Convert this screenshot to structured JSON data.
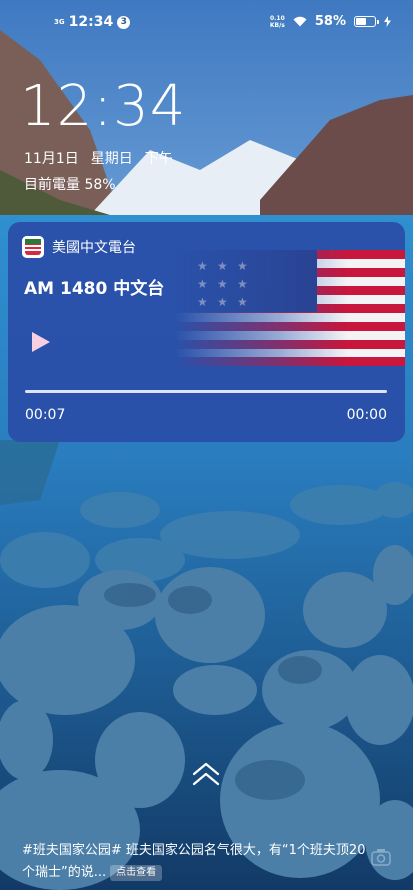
{
  "status_bar": {
    "network_type": "3G",
    "time": "12:34",
    "notification_count": "3",
    "net_speed_value": "0.10",
    "net_speed_unit": "KB/s",
    "battery_percent": "58%",
    "battery_level": 0.58
  },
  "lockscreen": {
    "clock": "12:34",
    "date": "11月1日",
    "weekday": "星期日",
    "ampm": "下午",
    "battery_info": "目前電量 58%"
  },
  "media_card": {
    "app_name": "美國中文電台",
    "title": "AM 1480 中文台",
    "elapsed": "00:07",
    "remaining": "00:00",
    "progress": 0.0
  },
  "bottom": {
    "caption": "#班夫国家公园# 班夫国家公园名气很大，有“1个班夫顶20个瑞士”的说...",
    "tag_label": "点击查看"
  },
  "icons": [
    "wifi-icon",
    "battery-icon",
    "charging-icon",
    "play-icon",
    "swipe-up-icon",
    "camera-icon",
    "app-icon"
  ]
}
